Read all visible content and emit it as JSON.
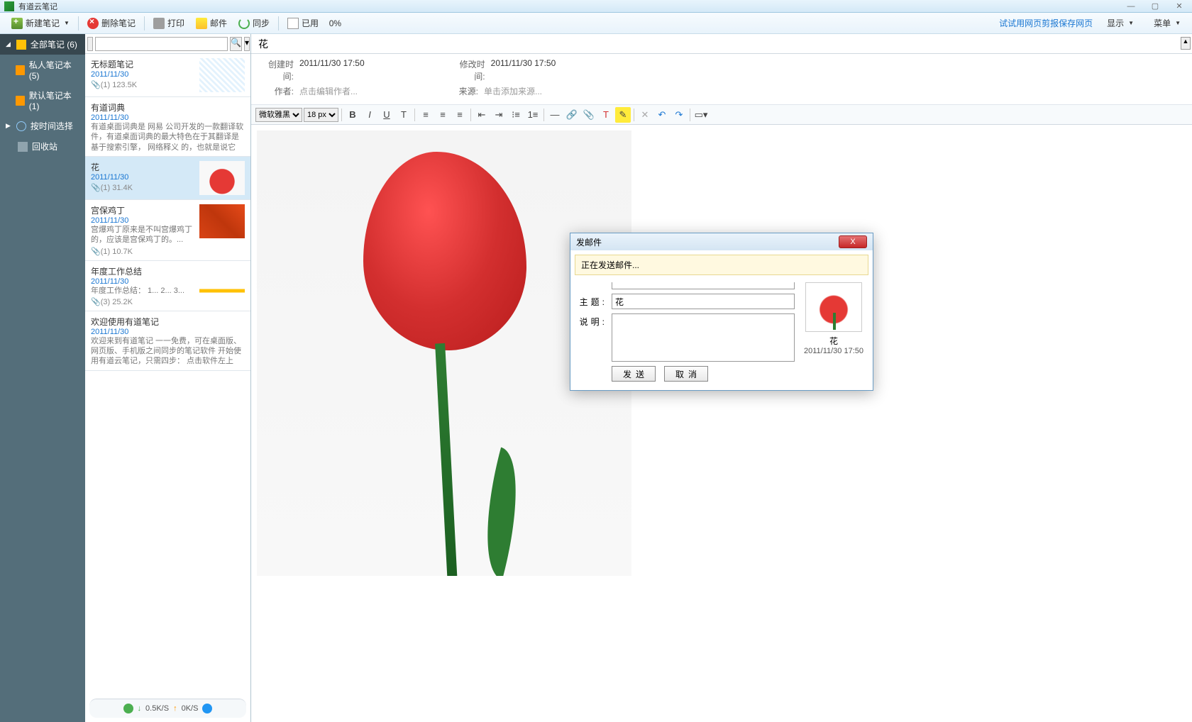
{
  "titlebar": {
    "app_name": "有道云笔记"
  },
  "toolbar": {
    "new_note": "新建笔记",
    "delete_note": "删除笔记",
    "print": "打印",
    "mail": "邮件",
    "sync": "同步",
    "used": "已用",
    "used_pct": "0%",
    "tip_link": "试试用网页剪报保存网页",
    "display": "显示",
    "menu": "菜单"
  },
  "sidebar": {
    "all_notes": "全部笔记 (6)",
    "items": [
      {
        "label": "私人笔记本 (5)"
      },
      {
        "label": "默认笔记本 (1)"
      }
    ],
    "by_time": "按时间选择",
    "trash": "回收站"
  },
  "notelist": {
    "items": [
      {
        "title": "无标题笔记",
        "date": "2011/11/30",
        "meta": "📎(1) 123.5K",
        "thumb": "map"
      },
      {
        "title": "有道词典",
        "date": "2011/11/30",
        "preview": "有道桌面词典是 网易 公司开发的一款翻译软件，有道桌面词典的最大特色在于其翻译是基于搜索引擎， 网络释义 的，也就是说它所...",
        "meta": ""
      },
      {
        "title": "花",
        "date": "2011/11/30",
        "meta": "📎(1) 31.4K",
        "thumb": "flower",
        "selected": true
      },
      {
        "title": "宫保鸡丁",
        "date": "2011/11/30",
        "preview": "宫爆鸡丁原来是不叫宫爆鸡丁的，应该是宫保鸡丁的。...",
        "meta": "📎(1) 10.7K",
        "thumb": "food"
      },
      {
        "title": "年度工作总结",
        "date": "2011/11/30",
        "preview": "年度工作总结： 1... 2... 3...",
        "meta": "📎(3) 25.2K",
        "thumb": "chart"
      },
      {
        "title": "欢迎使用有道笔记",
        "date": "2011/11/30",
        "preview": "欢迎来到有道笔记 一一免费，可在桌面版、网页版、手机版之间同步的笔记软件 开始使用有道云笔记，只需四步： 点击软件左上角...",
        "meta": ""
      }
    ],
    "status": {
      "down": "0.5K/S",
      "up": "0K/S"
    }
  },
  "editor": {
    "title": "花",
    "meta": {
      "created_label": "创建时间:",
      "created_val": "2011/11/30 17:50",
      "modified_label": "修改时间:",
      "modified_val": "2011/11/30 17:50",
      "author_label": "作者:",
      "author_val": "点击编辑作者...",
      "source_label": "来源:",
      "source_val": "单击添加来源..."
    },
    "toolbar": {
      "font": "微软雅黑",
      "size": "18 px"
    }
  },
  "dialog": {
    "title": "发邮件",
    "status": "正在发送邮件...",
    "subject_label": "主题:",
    "subject_value": "花",
    "desc_label": "说明:",
    "preview_name": "花",
    "preview_date": "2011/11/30 17:50",
    "send": "发送",
    "cancel": "取消"
  }
}
